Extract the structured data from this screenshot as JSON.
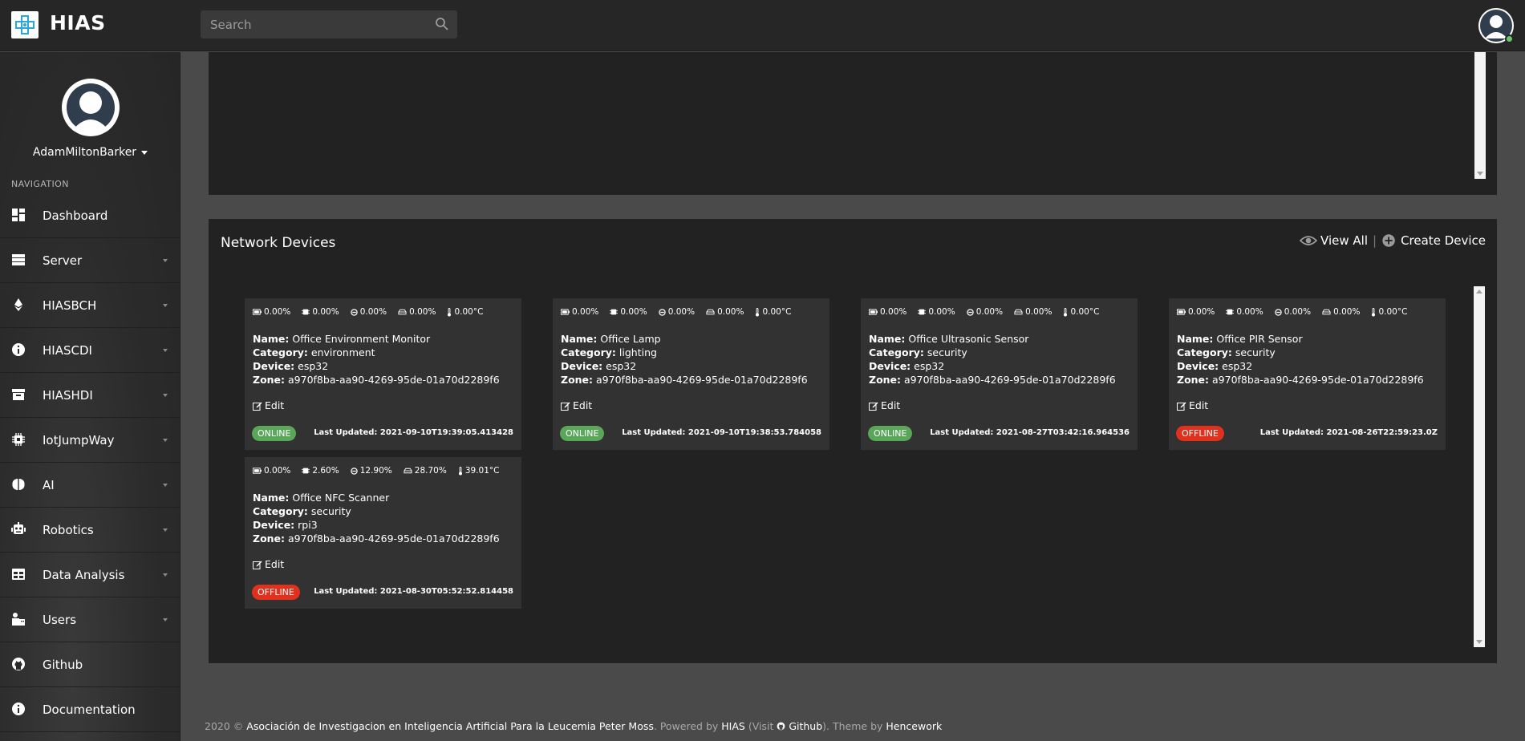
{
  "header": {
    "brand": "HIAS",
    "search_placeholder": "Search"
  },
  "sidebar": {
    "user_name": "AdamMiltonBarker",
    "nav_title": "NAVIGATION",
    "items": [
      {
        "label": "Dashboard",
        "icon": "dashboard-icon",
        "has_submenu": false
      },
      {
        "label": "Server",
        "icon": "server-icon",
        "has_submenu": true
      },
      {
        "label": "HIASBCH",
        "icon": "ethereum-icon",
        "has_submenu": true
      },
      {
        "label": "HIASCDI",
        "icon": "info-circle-icon",
        "has_submenu": true
      },
      {
        "label": "HIASHDI",
        "icon": "archive-icon",
        "has_submenu": true
      },
      {
        "label": "IotJumpWay",
        "icon": "chip-icon",
        "has_submenu": true
      },
      {
        "label": "AI",
        "icon": "brain-icon",
        "has_submenu": true
      },
      {
        "label": "Robotics",
        "icon": "robot-icon",
        "has_submenu": true
      },
      {
        "label": "Data Analysis",
        "icon": "table-icon",
        "has_submenu": true
      },
      {
        "label": "Users",
        "icon": "users-icon",
        "has_submenu": true
      },
      {
        "label": "Github",
        "icon": "github-icon",
        "has_submenu": false
      },
      {
        "label": "Documentation",
        "icon": "info-circle-icon",
        "has_submenu": false
      }
    ]
  },
  "network_devices": {
    "title": "Network Devices",
    "view_all": "View All",
    "separator": "|",
    "create": "Create Device",
    "edit_label": "Edit",
    "field_labels": {
      "name": "Name:",
      "category": "Category:",
      "device": "Device:",
      "zone": "Zone:"
    },
    "devices": [
      {
        "stats": [
          "0.00%",
          "0.00%",
          "0.00%",
          "0.00%",
          "0.00°C"
        ],
        "name": "Office Environment Monitor",
        "category": "environment",
        "device": "esp32",
        "zone": "a970f8ba-aa90-4269-95de-01a70d2289f6",
        "status": "ONLINE",
        "updated": "Last Updated: 2021-09-10T19:39:05.413428"
      },
      {
        "stats": [
          "0.00%",
          "0.00%",
          "0.00%",
          "0.00%",
          "0.00°C"
        ],
        "name": "Office Lamp",
        "category": "lighting",
        "device": "esp32",
        "zone": "a970f8ba-aa90-4269-95de-01a70d2289f6",
        "status": "ONLINE",
        "updated": "Last Updated: 2021-09-10T19:38:53.784058"
      },
      {
        "stats": [
          "0.00%",
          "0.00%",
          "0.00%",
          "0.00%",
          "0.00°C"
        ],
        "name": "Office Ultrasonic Sensor",
        "category": "security",
        "device": "esp32",
        "zone": "a970f8ba-aa90-4269-95de-01a70d2289f6",
        "status": "ONLINE",
        "updated": "Last Updated: 2021-08-27T03:42:16.964536"
      },
      {
        "stats": [
          "0.00%",
          "0.00%",
          "0.00%",
          "0.00%",
          "0.00°C"
        ],
        "name": "Office PIR Sensor",
        "category": "security",
        "device": "esp32",
        "zone": "a970f8ba-aa90-4269-95de-01a70d2289f6",
        "status": "OFFLINE",
        "updated": "Last Updated: 2021-08-26T22:59:23.0Z"
      },
      {
        "stats": [
          "0.00%",
          "2.60%",
          "12.90%",
          "28.70%",
          "39.01°C"
        ],
        "name": "Office NFC Scanner",
        "category": "security",
        "device": "rpi3",
        "zone": "a970f8ba-aa90-4269-95de-01a70d2289f6",
        "status": "OFFLINE",
        "updated": "Last Updated: 2021-08-30T05:52:52.814458"
      }
    ]
  },
  "footer": {
    "year": "2020 ©",
    "org": "Asociación de Investigacion en Inteligencia Artificial Para la Leucemia Peter Moss",
    "powered": ". Powered by",
    "hias": "HIAS",
    "visit": "(Visit",
    "github": "Github",
    "theme": "). Theme by",
    "theme_author": "Hencework"
  },
  "colors": {
    "online": "#5aa75a",
    "offline": "#e0301e",
    "panel": "#222222",
    "card": "#323232"
  }
}
